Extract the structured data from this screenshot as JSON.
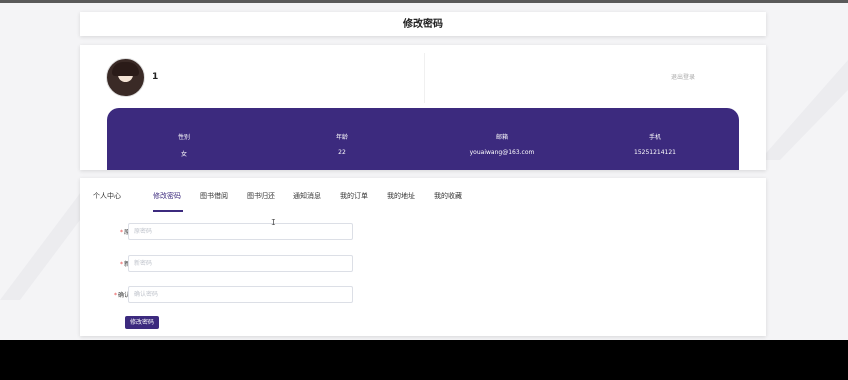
{
  "page_title": "修改密码",
  "profile": {
    "username": "1",
    "logout": "退出登录",
    "stats": [
      {
        "label": "性别",
        "value": "女"
      },
      {
        "label": "年龄",
        "value": "22"
      },
      {
        "label": "邮箱",
        "value": "youaiwang@163.com"
      },
      {
        "label": "手机",
        "value": "15251214121"
      }
    ]
  },
  "tabs": [
    {
      "label": "个人中心",
      "active": false
    },
    {
      "label": "修改密码",
      "active": true
    },
    {
      "label": "图书借阅",
      "active": false
    },
    {
      "label": "图书归还",
      "active": false
    },
    {
      "label": "通知消息",
      "active": false
    },
    {
      "label": "我的订单",
      "active": false
    },
    {
      "label": "我的地址",
      "active": false
    },
    {
      "label": "我的收藏",
      "active": false
    }
  ],
  "form": {
    "fields": [
      {
        "label": "原密码",
        "placeholder": "原密码",
        "value": ""
      },
      {
        "label": "新密码",
        "placeholder": "新密码",
        "value": ""
      },
      {
        "label": "确认密码",
        "placeholder": "确认密码",
        "value": ""
      }
    ],
    "submit_label": "修改密码"
  },
  "cursor_glyph": "I",
  "colors": {
    "accent": "#3c2a7e",
    "required": "#e64a4a",
    "background": "#f4f4f6"
  }
}
